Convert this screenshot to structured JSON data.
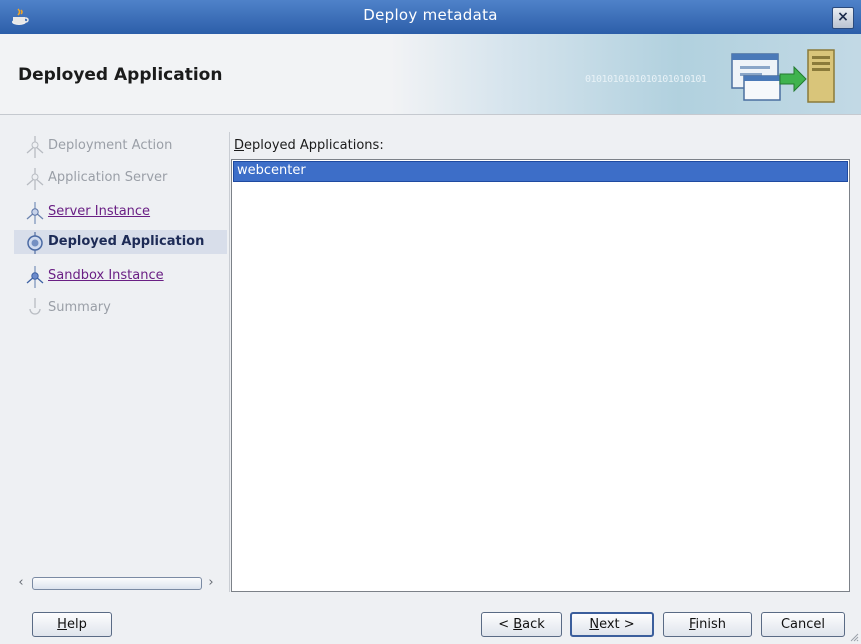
{
  "window": {
    "title": "Deploy metadata",
    "close_glyph": "×"
  },
  "header": {
    "title": "Deployed Application",
    "binary_text": "0101010101010101010101",
    "graphic": "deploy-wizard-graphic"
  },
  "steps": [
    {
      "label": "Deployment Action",
      "state": "disabled"
    },
    {
      "label": "Application Server",
      "state": "disabled"
    },
    {
      "label": "Server Instance",
      "state": "link"
    },
    {
      "label": "Deployed Application",
      "state": "current"
    },
    {
      "label": "Sandbox Instance",
      "state": "link"
    },
    {
      "label": "Summary",
      "state": "disabled"
    }
  ],
  "sidebar_scroll": {
    "left_arrow": "‹",
    "right_arrow": "›"
  },
  "main": {
    "list_label_mnemonic": "D",
    "list_label_rest": "eployed Applications:",
    "items": [
      {
        "label": "webcenter",
        "selected": true
      }
    ]
  },
  "buttons": {
    "help": {
      "mnemonic": "H",
      "rest": "elp"
    },
    "back": {
      "prefix": "< ",
      "mnemonic": "B",
      "rest": "ack"
    },
    "next": {
      "mnemonic": "N",
      "rest": "ext >"
    },
    "finish": {
      "mnemonic": "F",
      "rest": "inish"
    },
    "cancel": {
      "label": "Cancel"
    }
  },
  "colors": {
    "titlebar": "#3a6db7",
    "selection": "#3d6ec8",
    "link": "#6a1f84",
    "current_step": "#1d2b56"
  }
}
